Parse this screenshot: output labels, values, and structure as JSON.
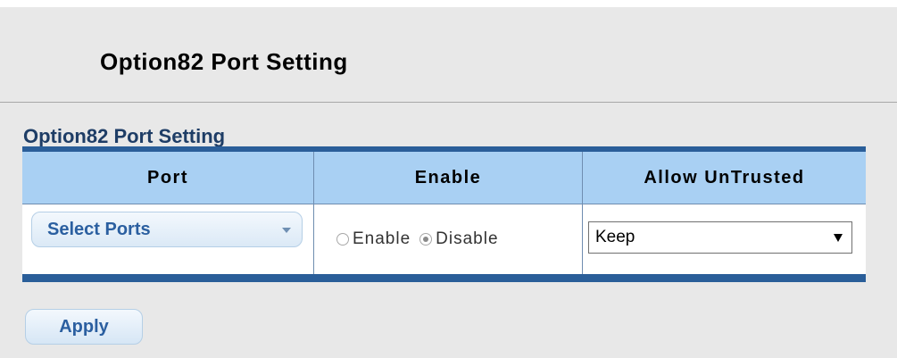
{
  "page": {
    "title": "Option82 Port Setting"
  },
  "section": {
    "title": "Option82 Port Setting"
  },
  "table": {
    "headers": [
      "Port",
      "Enable",
      "Allow UnTrusted"
    ],
    "row": {
      "port_select_label": "Select Ports",
      "enable_options": [
        {
          "label": "Enable",
          "checked": false
        },
        {
          "label": "Disable",
          "checked": true
        }
      ],
      "allow_untrusted_value": "Keep"
    }
  },
  "actions": {
    "apply_label": "Apply"
  },
  "colors": {
    "header_bg": "#a9d0f3",
    "bar": "#2a5e99",
    "section_title": "#1e3d66",
    "button_text": "#2b5fa0",
    "panel_bg": "#e8e8e8"
  },
  "icons": {
    "select_caret": "chevron-down-icon",
    "dropdown_arrow": "triangle-down-icon"
  }
}
